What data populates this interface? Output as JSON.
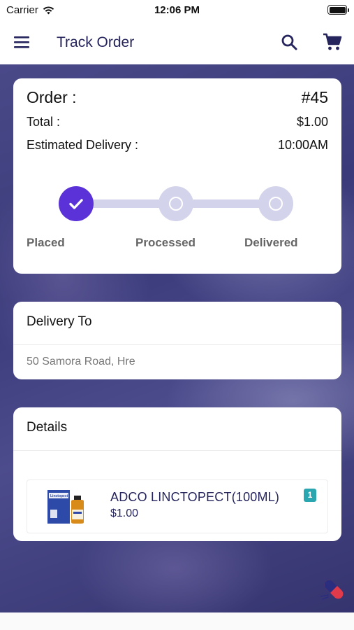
{
  "status_bar": {
    "carrier": "Carrier",
    "time": "12:06 PM"
  },
  "header": {
    "title": "Track Order"
  },
  "order": {
    "order_label": "Order :",
    "order_number": "#45",
    "total_label": "Total :",
    "total_value": "$1.00",
    "eta_label": "Estimated Delivery :",
    "eta_value": "10:00AM",
    "steps": [
      {
        "label": "Placed",
        "done": true
      },
      {
        "label": "Processed",
        "done": false
      },
      {
        "label": "Delivered",
        "done": false
      }
    ]
  },
  "delivery": {
    "title": "Delivery To",
    "address": "50 Samora Road, Hre"
  },
  "details": {
    "title": "Details",
    "items": [
      {
        "name": "ADCO LINCTOPECT(100ML)",
        "price": "$1.00",
        "quantity": "1",
        "image_text": "Linctopect"
      }
    ]
  },
  "colors": {
    "accent": "#5a32d8",
    "navy": "#25245c",
    "pending": "#d3d3ec",
    "badge": "#2aa6b0"
  }
}
